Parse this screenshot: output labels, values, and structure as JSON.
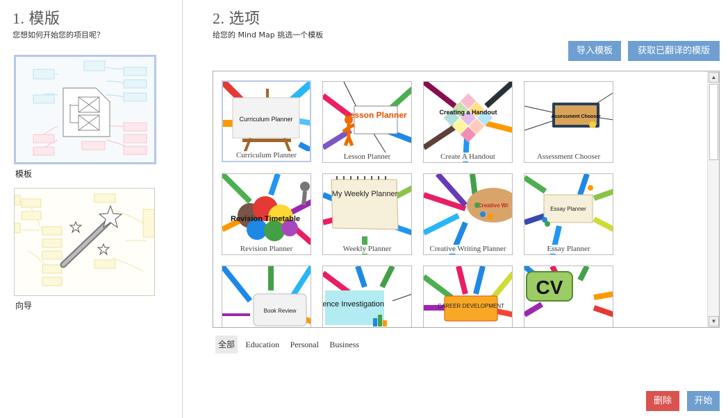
{
  "left": {
    "title": "1. 模版",
    "subtitle": "您想如何开始您的项目呢？",
    "modes": [
      {
        "label": "模板",
        "icon": "template-grid-icon",
        "selected": true
      },
      {
        "label": "向导",
        "icon": "magic-wand-icon",
        "selected": false
      }
    ]
  },
  "right": {
    "title": "2. 选项",
    "subtitle": "给您的 Mind Map 挑选一个模板",
    "buttons": {
      "import_label": "导入模板",
      "translated_label": "获取已翻译的模版"
    }
  },
  "templates": [
    {
      "label": "Curriculum Planner",
      "art": "Curriculum Planner",
      "selected": true
    },
    {
      "label": "Lesson Planner",
      "art": "Lesson Planner"
    },
    {
      "label": "Create A Handout",
      "art": "Creating a Handout"
    },
    {
      "label": "Assessment Chooser",
      "art": "Assessment Chooser"
    },
    {
      "label": "Revision Planner",
      "art": "Revision Timetable"
    },
    {
      "label": "Weekly Planner",
      "art": "My Weekly Planner"
    },
    {
      "label": "Creative Writing Planner",
      "art": "Creative Wr"
    },
    {
      "label": "Essay Planner",
      "art": "Essay Planner"
    },
    {
      "label": "",
      "art": "Book Review"
    },
    {
      "label": "",
      "art": "Science Investigation"
    },
    {
      "label": "",
      "art": "CAREER DEVELOPMENT"
    },
    {
      "label": "",
      "art": "CV"
    }
  ],
  "filters": [
    {
      "label": "全部",
      "active": true
    },
    {
      "label": "Education"
    },
    {
      "label": "Personal"
    },
    {
      "label": "Business"
    }
  ],
  "footer": {
    "delete_label": "删除",
    "start_label": "开始"
  },
  "colors": {
    "primary_button": "#6f9fd0",
    "danger_button": "#d9534f",
    "selected_border": "#b5c7e8"
  }
}
